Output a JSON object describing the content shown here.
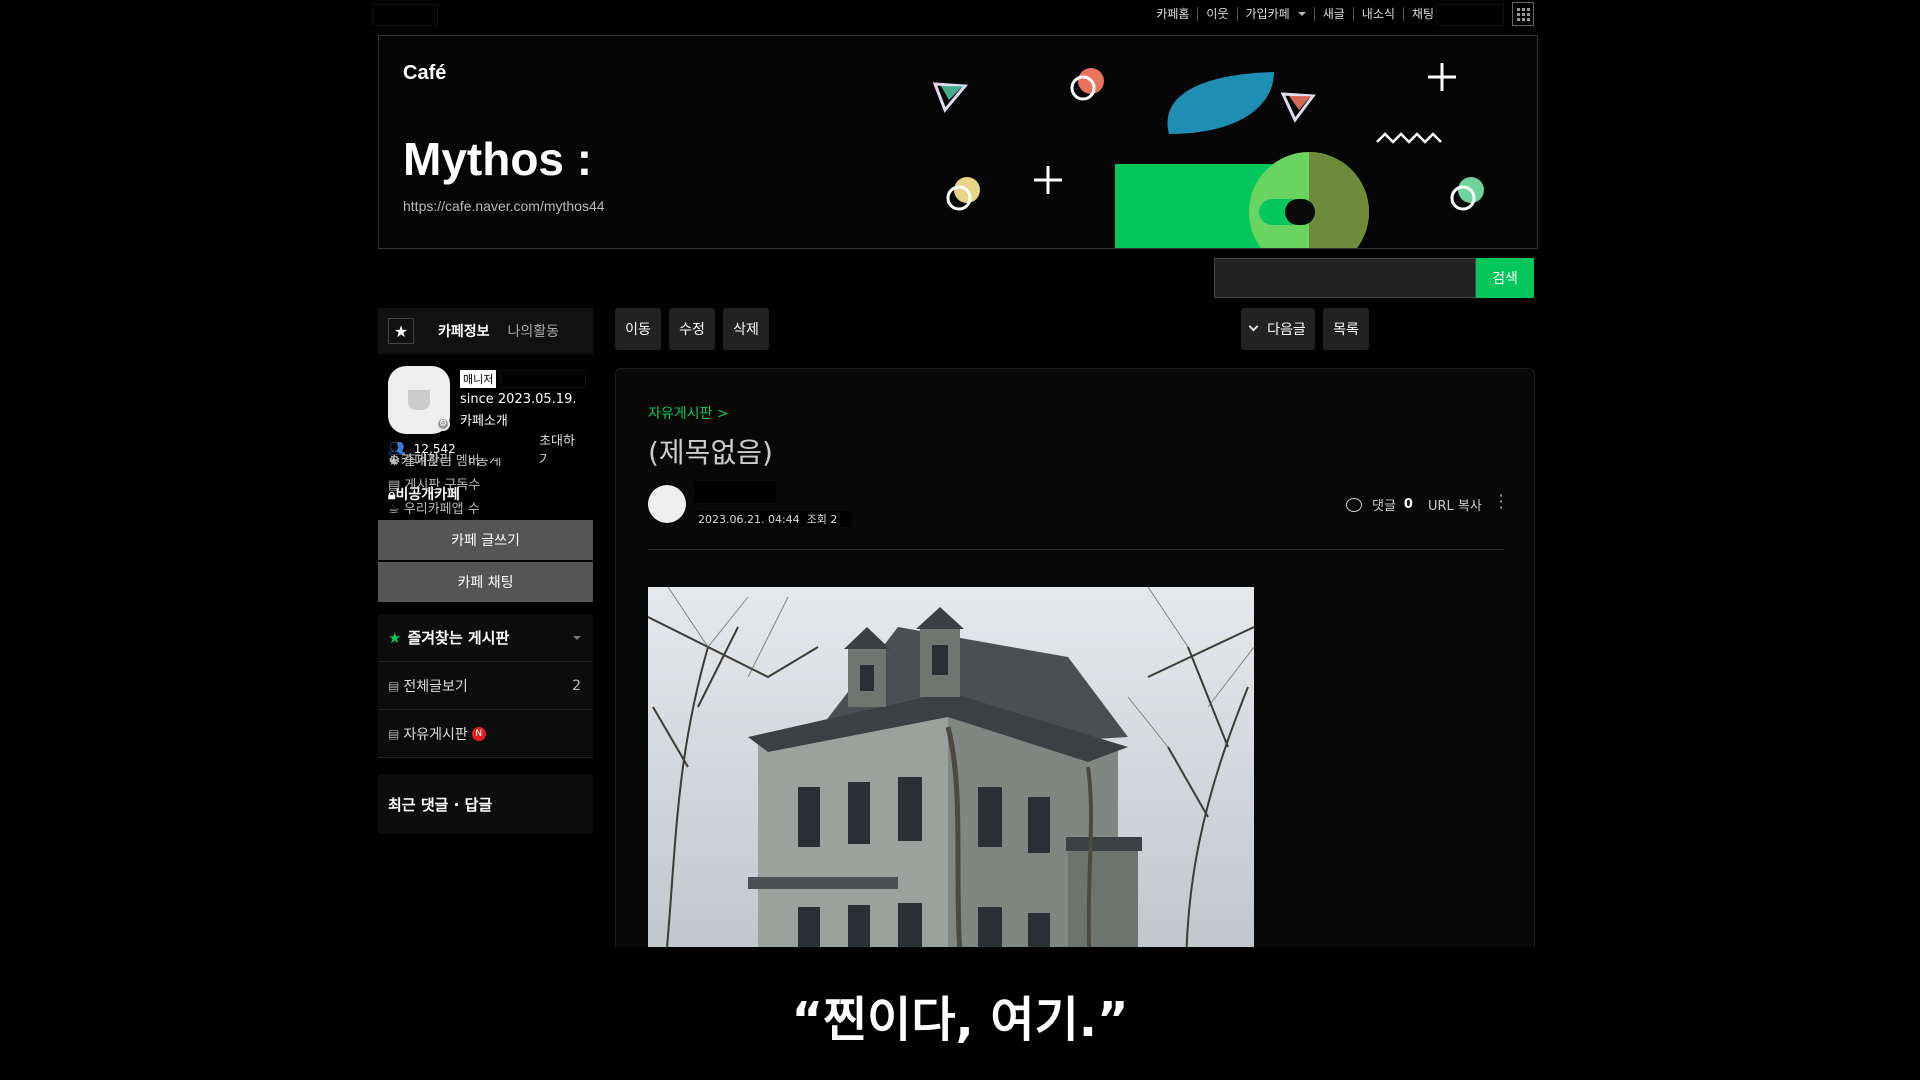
{
  "topnav": {
    "items": [
      "카페홈",
      "이웃",
      "가입카페",
      "새글",
      "내소식",
      "채팅"
    ]
  },
  "banner": {
    "logo": "Café",
    "title": "Mythos :",
    "url": "https://cafe.naver.com/mythos44"
  },
  "search": {
    "placeholder": "",
    "button": "검색"
  },
  "sidebar": {
    "tab_info": "카페정보",
    "tab_activity": "나의활동",
    "manager_badge": "매니저",
    "since": "since 2023.05.19.",
    "intro": "카페소개",
    "admin": "카페관리",
    "stats": "통계",
    "private": "비공개카페",
    "member_count": "12,542",
    "invite": "초대하기",
    "stat_items": [
      "즐겨찾는 멤버",
      "게시판 구독수",
      "우리카페앱 수"
    ],
    "write_button": "카페 글쓰기",
    "chat_button": "카페 채팅",
    "favorites_title": "즐겨찾는 게시판",
    "boards": [
      {
        "label": "전체글보기",
        "count": "2"
      },
      {
        "label": "자유게시판",
        "badge": "N"
      }
    ],
    "recent_title": "최근 댓글 · 답글"
  },
  "toolbar": {
    "move": "이동",
    "edit": "수정",
    "delete": "삭제",
    "next": "다음글",
    "list": "목록"
  },
  "post": {
    "breadcrumb": "자유게시판 >",
    "title": "(제목없음)",
    "date": "2023.06.21. 04:44",
    "views": "조회 2",
    "comment_label": "댓글",
    "comment_count": "0",
    "url_copy": "URL 복사"
  },
  "subtitle": "“찐이다, 여기.”",
  "colors": {
    "accent": "#03c75a",
    "new_badge": "#e02020"
  }
}
